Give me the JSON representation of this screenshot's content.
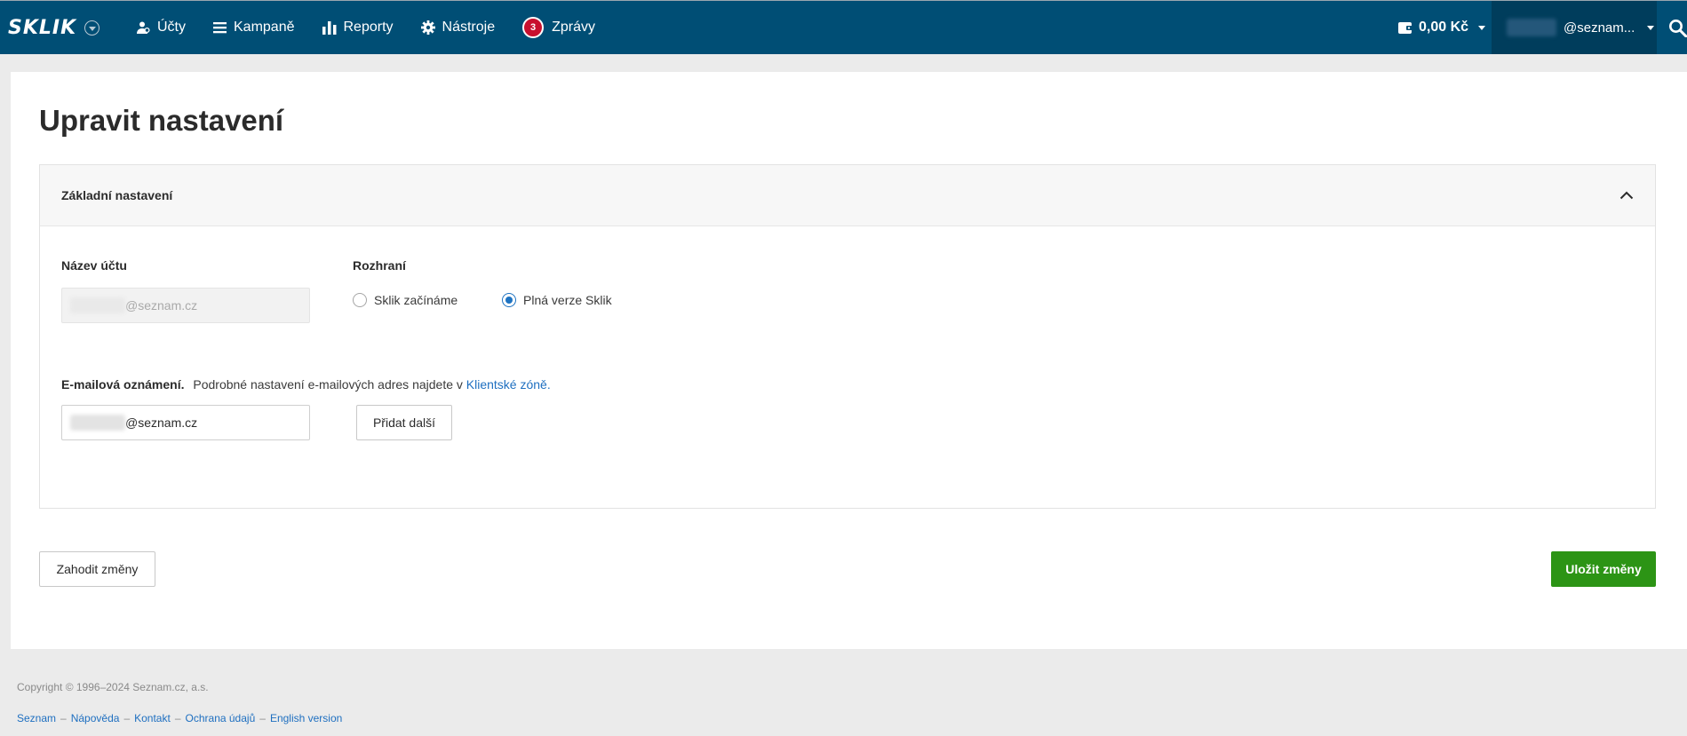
{
  "topbar": {
    "logo": "SKLIK",
    "nav": [
      {
        "label": "Účty",
        "icon": "accounts-icon"
      },
      {
        "label": "Kampaně",
        "icon": "menu-icon"
      },
      {
        "label": "Reporty",
        "icon": "bar-chart-icon"
      },
      {
        "label": "Nástroje",
        "icon": "gear-icon"
      },
      {
        "label": "Zprávy",
        "icon": "messages-badge",
        "badge": "3"
      }
    ],
    "balance": "0,00 Kč",
    "user": "@seznam..."
  },
  "page": {
    "title": "Upravit nastavení"
  },
  "panel": {
    "title": "Základní nastavení",
    "account_name_label": "Název účtu",
    "account_name_value": "@seznam.cz",
    "interface_label": "Rozhraní",
    "interface_options": [
      {
        "label": "Sklik začínáme",
        "checked": false
      },
      {
        "label": "Plná verze Sklik",
        "checked": true
      }
    ],
    "email_label": "E-mailová oznámení.",
    "email_text": "Podrobné nastavení e-mailových adres najdete v",
    "email_link": "Klientské zóně.",
    "email_value": "@seznam.cz",
    "add_more": "Přidat další"
  },
  "actions": {
    "discard": "Zahodit změny",
    "save": "Uložit změny"
  },
  "footer": {
    "copyright": "Copyright © 1996–2024 Seznam.cz, a.s.",
    "links": [
      "Seznam",
      "Nápověda",
      "Kontakt",
      "Ochrana údajů",
      "English version"
    ],
    "separator": "–"
  },
  "colors": {
    "topbar": "#004e75",
    "primary_button": "#2c9415",
    "link": "#1e6fc0",
    "badge": "#c8102e"
  }
}
